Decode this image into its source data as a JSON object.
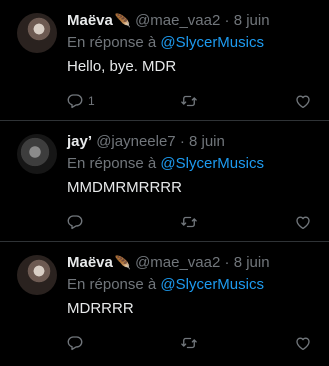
{
  "reply_prefix": "En réponse à",
  "tweets": [
    {
      "name": "Maëva",
      "feather": "🪶",
      "handle": "@mae_vaa2",
      "sep": "·",
      "date": "8 juin",
      "mention": "@SlycerMusics",
      "text": "Hello, bye. MDR",
      "reply_count": "1"
    },
    {
      "name": "jay’",
      "feather": "",
      "handle": "@jayneele7",
      "sep": "·",
      "date": "8 juin",
      "mention": "@SlycerMusics",
      "text": "MMDMRMRRRR",
      "reply_count": ""
    },
    {
      "name": "Maëva",
      "feather": "🪶",
      "handle": "@mae_vaa2",
      "sep": "·",
      "date": "8 juin",
      "mention": "@SlycerMusics",
      "text": "MDRRRR",
      "reply_count": ""
    }
  ],
  "colors": {
    "background": "#000000",
    "text": "#e7e9ea",
    "muted": "#71767b",
    "link": "#1d9bf0",
    "divider": "#2f3336"
  },
  "icons": [
    "reply-icon",
    "retweet-icon",
    "like-icon"
  ]
}
